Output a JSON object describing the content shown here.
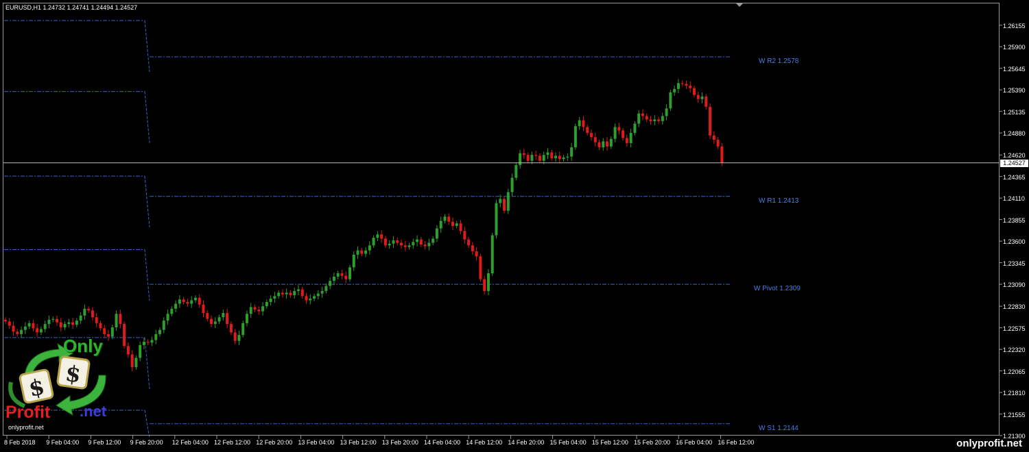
{
  "header": {
    "symbol": "EURUSD,H1",
    "ohlc": "1.24732 1.24741 1.24494 1.24527"
  },
  "watermark": "onlyprofit.net",
  "logo": {
    "only": "Only",
    "profit": "Profit",
    "net": ".net",
    "url": "onlyprofit.net"
  },
  "colors": {
    "background": "#000000",
    "bull_candle": "#2e9e2e",
    "bear_candle": "#e01b1b",
    "pivot_line": "#3b63c9",
    "pivot_label": "#4a7ee8",
    "current_price_line": "#c0c0c0",
    "axis_text": "#ffffff"
  },
  "chart_data": {
    "type": "candlestick",
    "symbol": "EURUSD",
    "timeframe": "H1",
    "ylim": [
      1.213,
      1.2638
    ],
    "current_price": 1.24527,
    "current_price_label": "1.24527",
    "price_ticks": [
      "1.26155",
      "1.25900",
      "1.25645",
      "1.25390",
      "1.25135",
      "1.24880",
      "1.24620",
      "1.24365",
      "1.24110",
      "1.23855",
      "1.23600",
      "1.23345",
      "1.23090",
      "1.22830",
      "1.22575",
      "1.22320",
      "1.22065",
      "1.21810",
      "1.21555",
      "1.21300"
    ],
    "time_labels": [
      "8 Feb 2018",
      "9 Feb 04:00",
      "9 Feb 12:00",
      "9 Feb 20:00",
      "12 Feb 04:00",
      "12 Feb 12:00",
      "12 Feb 20:00",
      "13 Feb 04:00",
      "13 Feb 12:00",
      "13 Feb 20:00",
      "14 Feb 04:00",
      "14 Feb 12:00",
      "14 Feb 20:00",
      "15 Feb 04:00",
      "15 Feb 12:00",
      "15 Feb 20:00",
      "16 Feb 04:00",
      "16 Feb 12:00"
    ],
    "pivot_levels": [
      {
        "label": "W R2 1.2578",
        "value": 1.2578
      },
      {
        "label": "W R1 1.2413",
        "value": 1.2413
      },
      {
        "label": "W Pivot 1.2309",
        "value": 1.2309
      },
      {
        "label": "W S1 1.2144",
        "value": 1.2144
      }
    ],
    "previous_week_levels": [
      1.2621,
      1.2537,
      1.2437,
      1.235,
      1.2246,
      1.216
    ],
    "closes": [
      1.2265,
      1.226,
      1.2253,
      1.225,
      1.2255,
      1.2259,
      1.2263,
      1.2257,
      1.2252,
      1.2256,
      1.2262,
      1.2267,
      1.2268,
      1.2264,
      1.2258,
      1.2262,
      1.2264,
      1.2261,
      1.2266,
      1.2272,
      1.228,
      1.2278,
      1.227,
      1.2263,
      1.2257,
      1.225,
      1.2247,
      1.2258,
      1.2274,
      1.2262,
      1.2236,
      1.2226,
      1.2211,
      1.2222,
      1.2237,
      1.2241,
      1.224,
      1.2243,
      1.225,
      1.2255,
      1.2266,
      1.2274,
      1.228,
      1.2286,
      1.2291,
      1.2288,
      1.2286,
      1.229,
      1.2293,
      1.2285,
      1.2275,
      1.2268,
      1.2262,
      1.2265,
      1.227,
      1.2275,
      1.2262,
      1.2252,
      1.2242,
      1.2249,
      1.2263,
      1.2274,
      1.2282,
      1.2279,
      1.2277,
      1.2283,
      1.2288,
      1.2292,
      1.2295,
      1.2299,
      1.2297,
      1.2299,
      1.2296,
      1.2301,
      1.2303,
      1.2295,
      1.229,
      1.2292,
      1.2295,
      1.2298,
      1.2301,
      1.2307,
      1.2313,
      1.2318,
      1.2322,
      1.2319,
      1.2315,
      1.2329,
      1.2344,
      1.2349,
      1.2345,
      1.2349,
      1.2355,
      1.2364,
      1.2368,
      1.2363,
      1.2355,
      1.2357,
      1.2361,
      1.2358,
      1.2355,
      1.2353,
      1.2355,
      1.2359,
      1.2362,
      1.2356,
      1.2354,
      1.2358,
      1.2363,
      1.2375,
      1.2384,
      1.2389,
      1.2383,
      1.2378,
      1.2381,
      1.2372,
      1.2362,
      1.2355,
      1.2348,
      1.2342,
      1.2315,
      1.2301,
      1.2322,
      1.2367,
      1.2405,
      1.241,
      1.2396,
      1.2418,
      1.2435,
      1.245,
      1.2464,
      1.2462,
      1.2455,
      1.2462,
      1.2461,
      1.2455,
      1.2462,
      1.2465,
      1.2458,
      1.2461,
      1.2457,
      1.2459,
      1.246,
      1.2471,
      1.2496,
      1.2503,
      1.2495,
      1.2488,
      1.2483,
      1.2477,
      1.2471,
      1.2478,
      1.2472,
      1.2481,
      1.2495,
      1.2491,
      1.2482,
      1.2476,
      1.2488,
      1.2499,
      1.2511,
      1.2508,
      1.2504,
      1.2502,
      1.2504,
      1.2502,
      1.2508,
      1.2517,
      1.2536,
      1.254,
      1.2547,
      1.2546,
      1.2544,
      1.2541,
      1.2533,
      1.2528,
      1.2531,
      1.2519,
      1.2485,
      1.248,
      1.2472,
      1.2453
    ]
  }
}
